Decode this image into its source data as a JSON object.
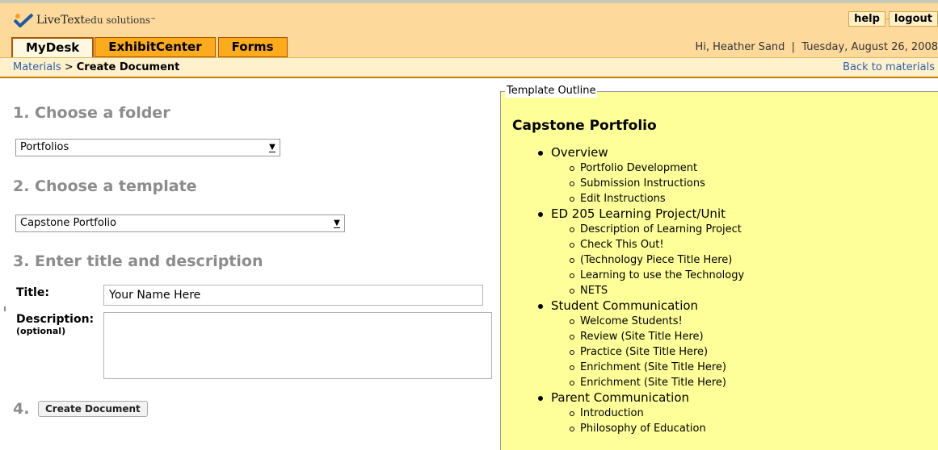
{
  "brand": {
    "name": "LiveText",
    "suffix": "edu solutions",
    "tm": "™"
  },
  "utility": {
    "help": "help",
    "logout": "logout"
  },
  "tabs": [
    {
      "label": "MyDesk",
      "active": true
    },
    {
      "label": "ExhibitCenter",
      "active": false
    },
    {
      "label": "Forms",
      "active": false
    }
  ],
  "greeting": "Hi, Heather Sand  |  Tuesday, August 26, 2008",
  "breadcrumb": {
    "parent": "Materials",
    "separator": " > ",
    "current": "Create Document"
  },
  "back_link": "Back to materials",
  "form": {
    "step1": {
      "heading": "1. Choose a folder",
      "selected": "Portfolios"
    },
    "step2": {
      "heading": "2. Choose a template",
      "selected": "Capstone Portfolio"
    },
    "step3": {
      "heading": "3. Enter title and description",
      "title_label": "Title:",
      "title_value": "Your Name Here",
      "description_label": "Description:",
      "description_hint": "(optional)"
    },
    "step4": {
      "number": "4.",
      "button": "Create Document"
    }
  },
  "outline": {
    "legend": "Template Outline",
    "title": "Capstone Portfolio",
    "sections": [
      {
        "label": "Overview",
        "items": [
          "Portfolio Development",
          "Submission Instructions",
          "Edit Instructions"
        ]
      },
      {
        "label": "ED 205 Learning Project/Unit",
        "items": [
          "Description of Learning Project",
          "Check This Out!",
          "(Technology Piece Title Here)",
          "Learning to use the Technology",
          "NETS"
        ]
      },
      {
        "label": "Student Communication",
        "items": [
          "Welcome Students!",
          "Review (Site Title Here)",
          "Practice (Site Title Here)",
          "Enrichment (Site Title Here)",
          "Enrichment (Site Title Here)"
        ]
      },
      {
        "label": "Parent Communication",
        "items": [
          "Introduction",
          "Philosophy of Education"
        ]
      }
    ]
  },
  "colors": {
    "header_bg": "#fed99c",
    "tab_bg": "#fbab1c",
    "outline_bg": "#ffff99",
    "link": "#2f5fa8",
    "step_heading": "#8c8c8c"
  }
}
